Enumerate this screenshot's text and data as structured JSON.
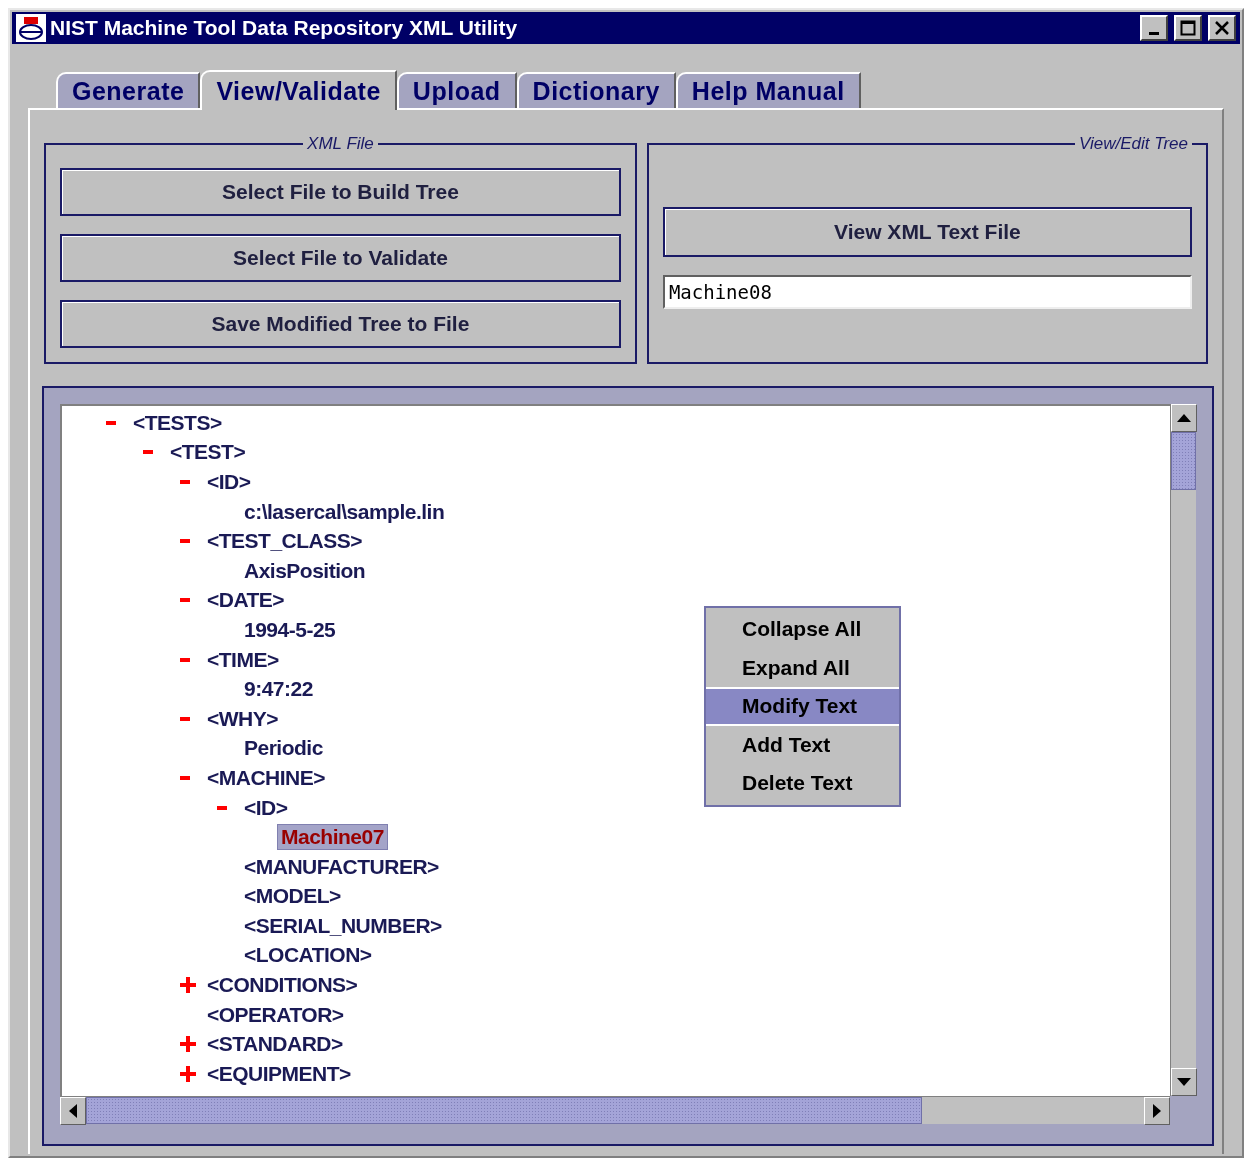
{
  "window": {
    "title": "NIST Machine Tool Data Repository XML Utility"
  },
  "tabs": [
    {
      "label": "Generate",
      "selected": false
    },
    {
      "label": "View/Validate",
      "selected": true
    },
    {
      "label": "Upload",
      "selected": false
    },
    {
      "label": "Dictionary",
      "selected": false
    },
    {
      "label": "Help Manual",
      "selected": false
    }
  ],
  "xml_file": {
    "title": "XML File",
    "buttons": [
      "Select File to Build Tree",
      "Select File to Validate",
      "Save Modified Tree to File"
    ]
  },
  "view_edit_tree": {
    "title": "View/Edit Tree",
    "button": "View XML Text File",
    "field": {
      "value": "Machine08"
    }
  },
  "tree": [
    {
      "label": "<TESTS>",
      "expanded": true,
      "selected": false,
      "children": [
        {
          "label": "<TEST>",
          "expanded": true,
          "selected": false,
          "children": [
            {
              "label": "<ID>",
              "expanded": true,
              "selected": false,
              "children": [
                {
                  "label": "c:\\lasercal\\sample.lin",
                  "selected": false
                }
              ]
            },
            {
              "label": "<TEST_CLASS>",
              "expanded": true,
              "selected": false,
              "children": [
                {
                  "label": "AxisPosition",
                  "selected": false
                }
              ]
            },
            {
              "label": "<DATE>",
              "expanded": true,
              "selected": false,
              "children": [
                {
                  "label": "1994-5-25",
                  "selected": false
                }
              ]
            },
            {
              "label": "<TIME>",
              "expanded": true,
              "selected": false,
              "children": [
                {
                  "label": "9:47:22",
                  "selected": false
                }
              ]
            },
            {
              "label": "<WHY>",
              "expanded": true,
              "selected": false,
              "children": [
                {
                  "label": "Periodic",
                  "selected": false
                }
              ]
            },
            {
              "label": "<MACHINE>",
              "expanded": true,
              "selected": false,
              "children": [
                {
                  "label": "<ID>",
                  "expanded": true,
                  "selected": false,
                  "children": [
                    {
                      "label": "Machine07",
                      "selected": true
                    }
                  ]
                },
                {
                  "label": "<MANUFACTURER>",
                  "selected": false
                },
                {
                  "label": "<MODEL>",
                  "selected": false
                },
                {
                  "label": "<SERIAL_NUMBER>",
                  "selected": false
                },
                {
                  "label": "<LOCATION>",
                  "selected": false
                }
              ]
            },
            {
              "label": "<CONDITIONS>",
              "expanded": false,
              "selected": false
            },
            {
              "label": "<OPERATOR>",
              "selected": false
            },
            {
              "label": "<STANDARD>",
              "expanded": false,
              "selected": false
            },
            {
              "label": "<EQUIPMENT>",
              "expanded": false,
              "selected": false
            }
          ]
        }
      ]
    }
  ],
  "context_menu": [
    {
      "label": "Collapse All",
      "selected": false
    },
    {
      "label": "Expand All",
      "selected": false
    },
    {
      "label": "Modify Text",
      "selected": true
    },
    {
      "label": "Add Text",
      "selected": false
    },
    {
      "label": "Delete Text",
      "selected": false
    }
  ]
}
